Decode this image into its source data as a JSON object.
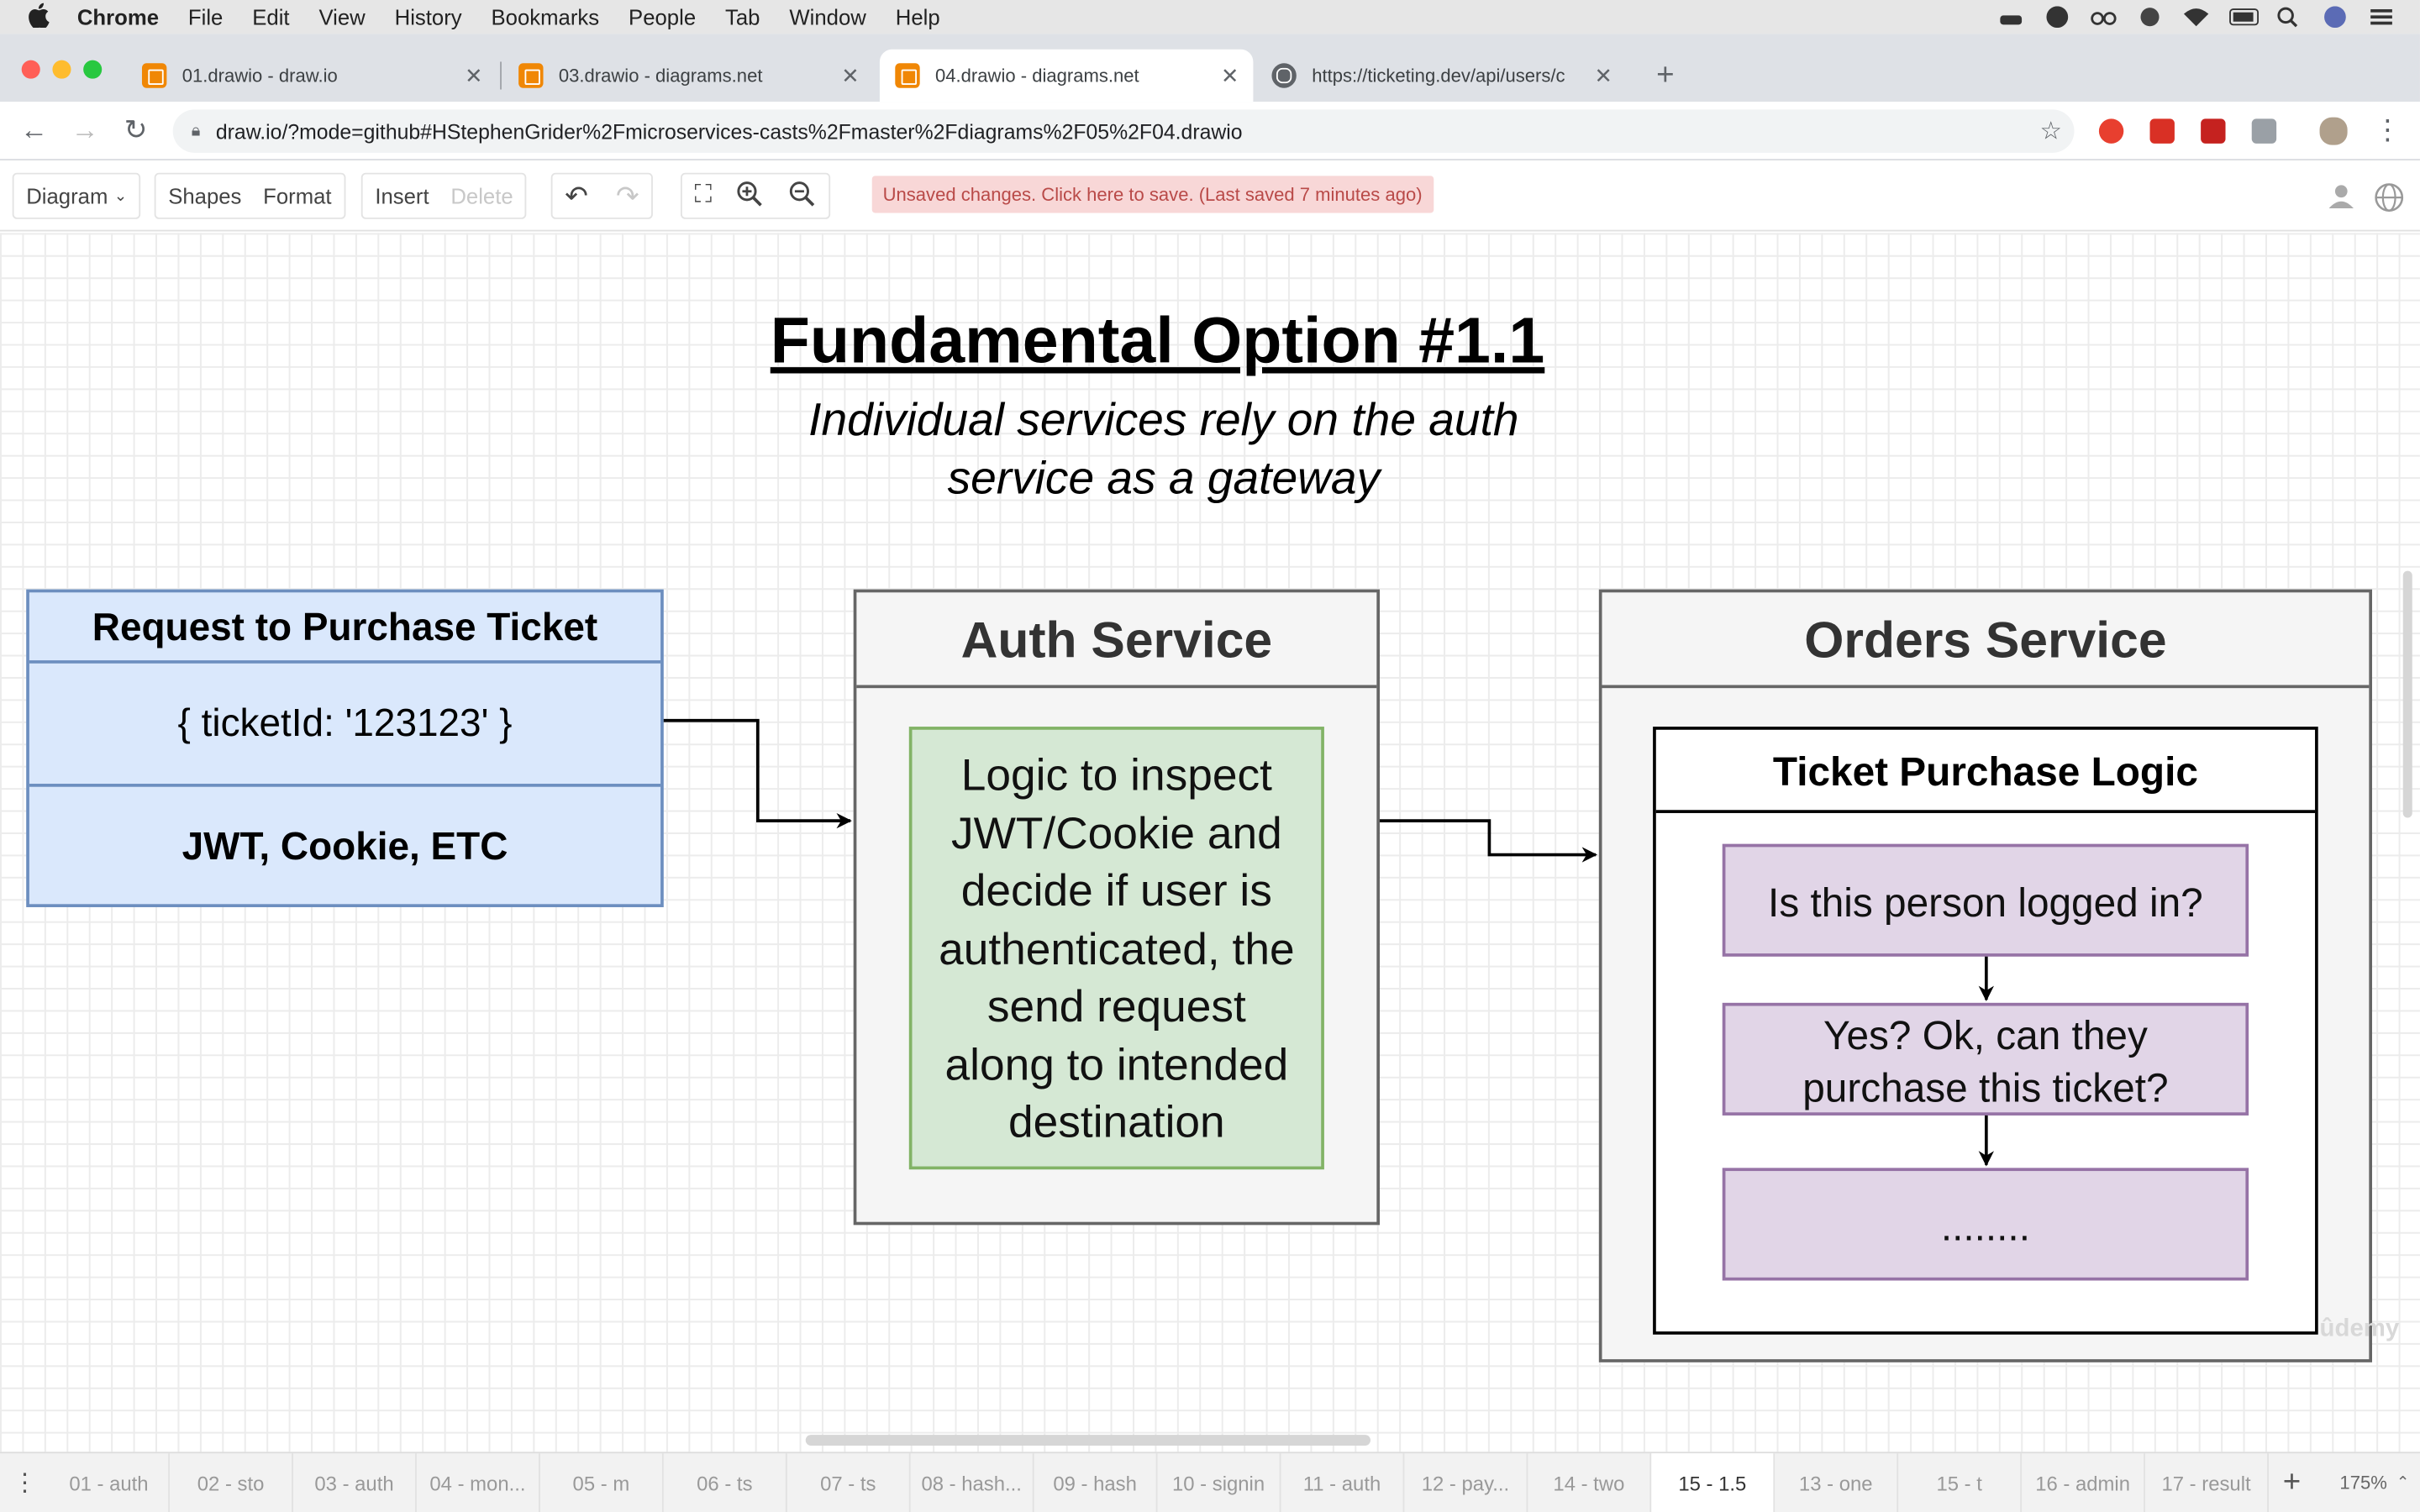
{
  "menubar": {
    "app": "Chrome",
    "items": [
      "File",
      "Edit",
      "View",
      "History",
      "Bookmarks",
      "People",
      "Tab",
      "Window",
      "Help"
    ]
  },
  "tabs": [
    {
      "title": "01.drawio - draw.io",
      "icon": "drawio-icon",
      "active": false
    },
    {
      "title": "03.drawio - diagrams.net",
      "icon": "drawio-icon",
      "active": false
    },
    {
      "title": "04.drawio - diagrams.net",
      "icon": "drawio-icon",
      "active": true
    },
    {
      "title": "https://ticketing.dev/api/users/c",
      "icon": "globe-icon",
      "active": false
    }
  ],
  "address": {
    "url": "draw.io/?mode=github#HStephenGrider%2Fmicroservices-casts%2Fmaster%2Fdiagrams%2F05%2F04.drawio"
  },
  "drawio_toolbar": {
    "diagram": "Diagram",
    "shapes": "Shapes",
    "format": "Format",
    "insert": "Insert",
    "delete": "Delete",
    "unsaved": "Unsaved changes. Click here to save. (Last saved 7 minutes ago)"
  },
  "diagram": {
    "title": "Fundamental Option #1.1",
    "subtitle_line1": "Individual services rely on the auth",
    "subtitle_line2": "service as a gateway",
    "request": {
      "header": "Request to Purchase Ticket",
      "body": "{ ticketId: '123123' }",
      "footer": "JWT, Cookie, ETC"
    },
    "auth": {
      "header": "Auth Service",
      "logic_lines": [
        "Logic to inspect",
        "JWT/Cookie and",
        "decide if user is",
        "authenticated, the",
        "send request",
        "along to intended",
        "destination"
      ]
    },
    "orders": {
      "header": "Orders Service",
      "inner_header": "Ticket Purchase Logic",
      "step1": "Is this person logged in?",
      "step2_line1": "Yes? Ok, can they",
      "step2_line2": "purchase this ticket?",
      "step3": "........"
    }
  },
  "pages": [
    "01 - auth",
    "02 - sto",
    "03 - auth",
    "04 - mon...",
    "05 - m",
    "06 - ts",
    "07 - ts",
    "08 - hash...",
    "09 - hash",
    "10 - signin",
    "11 - auth",
    "12 - pay...",
    "14 - two",
    "15 - 1.5",
    "13 - one",
    "15 - t",
    "16 - admin",
    "17 - result"
  ],
  "active_page": "15 - 1.5",
  "zoom": "175%",
  "colors": {
    "blue_fill": "#dae8fc",
    "blue_stroke": "#6c8ebf",
    "green_fill": "#d5e8d4",
    "green_stroke": "#82b366",
    "purple_fill": "#e1d5e7",
    "purple_stroke": "#9673a6",
    "unsaved_bg": "#f8d7d7"
  }
}
